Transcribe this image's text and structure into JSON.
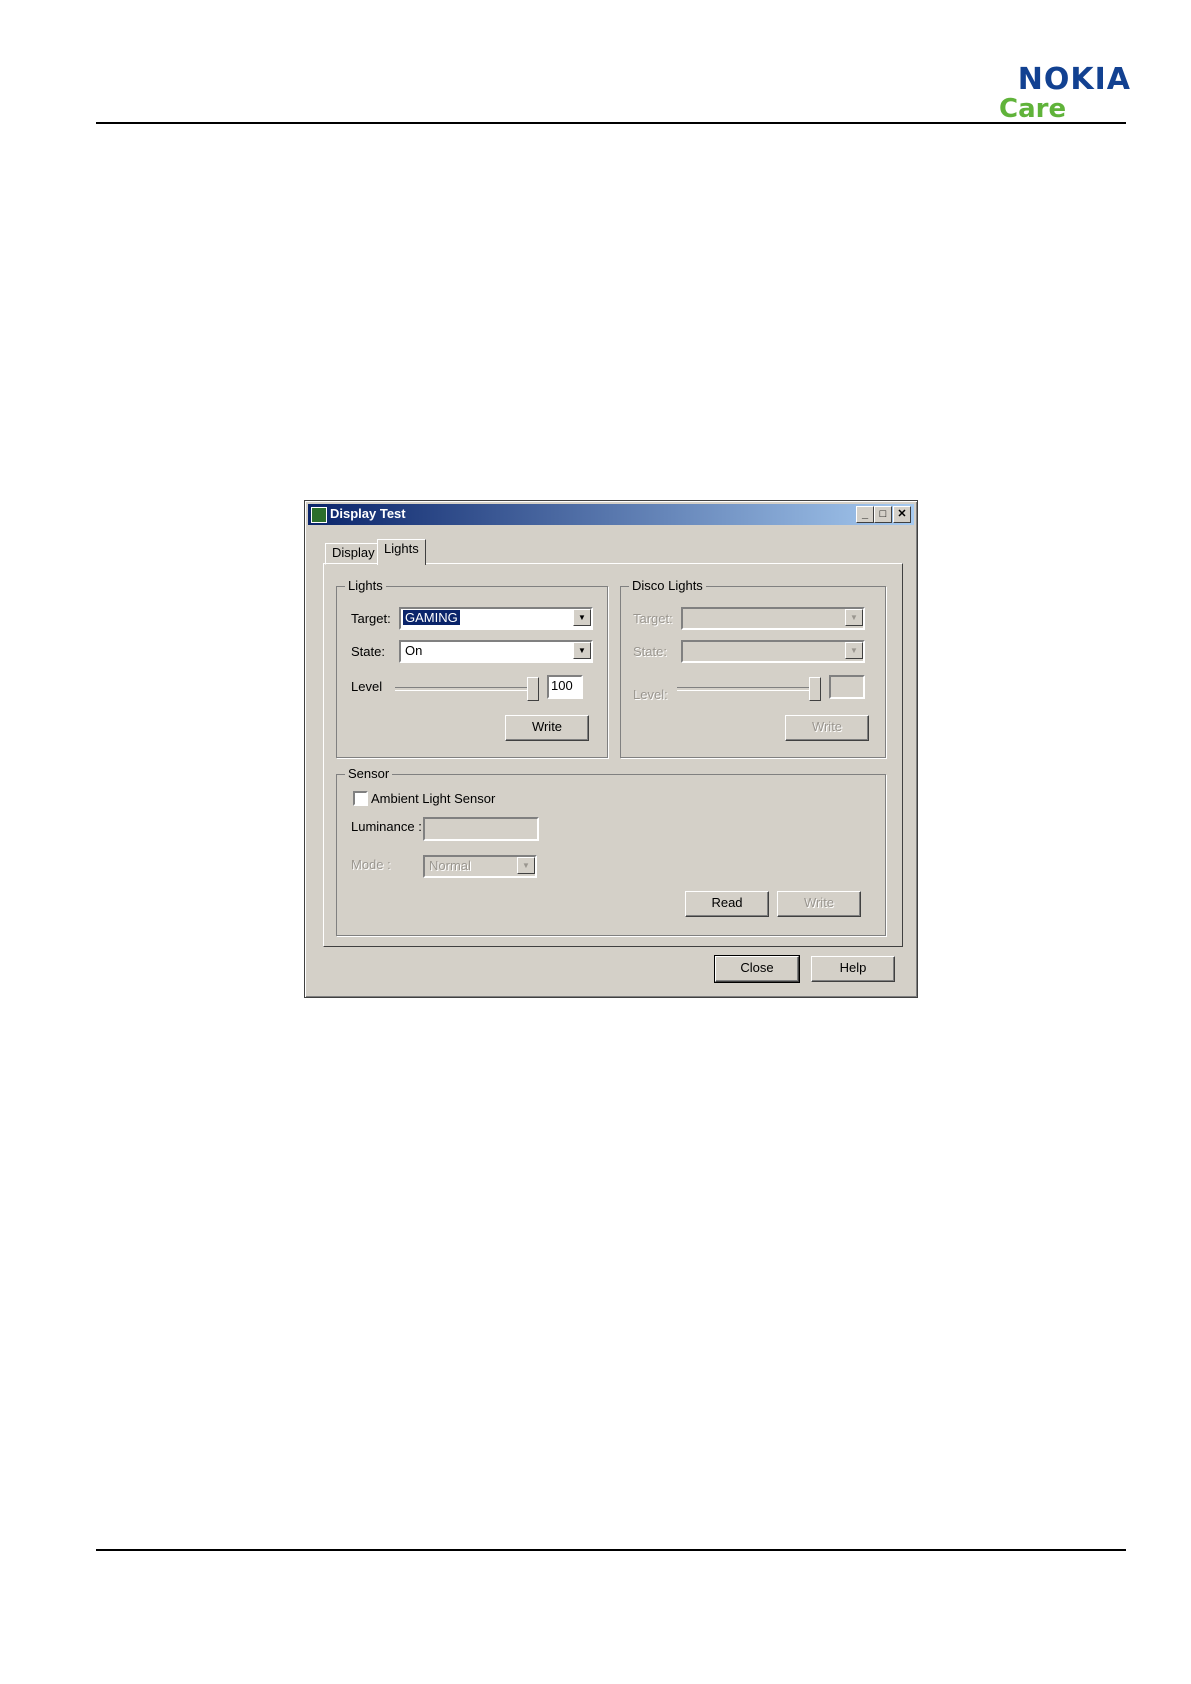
{
  "brand": {
    "name": "NOKIA",
    "tagline": "Care",
    "primary_color": "#124191",
    "accent_color": "#60b33a"
  },
  "window": {
    "title": "Display Test",
    "controls": {
      "minimize": "_",
      "maximize": "□",
      "close": "✕"
    },
    "tabs": [
      {
        "label": "Display"
      },
      {
        "label": "Lights",
        "active": true
      }
    ],
    "lights": {
      "group_label": "Lights",
      "target_label": "Target:",
      "target_value": "GAMING",
      "state_label": "State:",
      "state_value": "On",
      "level_label": "Level",
      "level_value": "100",
      "level_slider_fraction": 1.0,
      "write_label": "Write"
    },
    "disco": {
      "group_label": "Disco Lights",
      "target_label": "Target:",
      "state_label": "State:",
      "level_label": "Level:",
      "write_label": "Write"
    },
    "sensor": {
      "group_label": "Sensor",
      "ambient_label": "Ambient Light Sensor",
      "ambient_checked": false,
      "luminance_label": "Luminance :",
      "mode_label": "Mode :",
      "mode_value": "Normal",
      "read_label": "Read",
      "write_label": "Write"
    },
    "buttons": {
      "close": "Close",
      "help": "Help"
    }
  }
}
